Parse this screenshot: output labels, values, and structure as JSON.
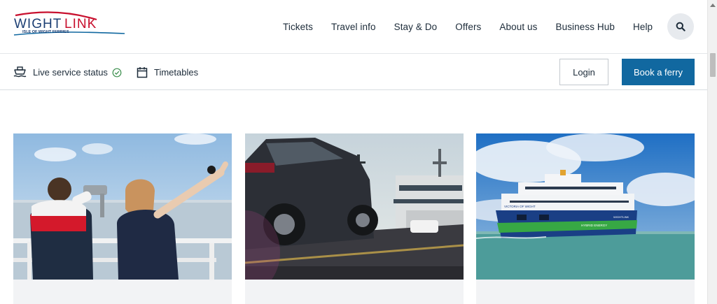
{
  "header": {
    "logo": {
      "text_primary": "WIGHT",
      "text_accent": "LINK",
      "tagline": "ISLE OF WIGHT FERRIES"
    },
    "nav": [
      {
        "label": "Tickets"
      },
      {
        "label": "Travel info"
      },
      {
        "label": "Stay & Do"
      },
      {
        "label": "Offers"
      },
      {
        "label": "About us"
      },
      {
        "label": "Business Hub"
      },
      {
        "label": "Help"
      }
    ],
    "search_icon": "search-icon"
  },
  "utility": {
    "live_status_label": "Live service status",
    "timetables_label": "Timetables",
    "login_label": "Login",
    "book_label": "Book a ferry"
  },
  "cards": [
    {
      "title": "",
      "image": "children-binoculars-photo"
    },
    {
      "title": "",
      "image": "car-ferry-ramp-photo"
    },
    {
      "title": "",
      "image": "victoria-of-wight-ferry-photo"
    }
  ],
  "ferry_image_text": {
    "hull_name": "VICTORIA OF WIGHT",
    "hull_band": "HYBRID ENERGY",
    "brand": "WIGHTLINK"
  },
  "colors": {
    "brand_blue": "#1168a0",
    "logo_red": "#c8102e",
    "text_dark": "#1c2b39",
    "check_green": "#3d8f4e"
  }
}
